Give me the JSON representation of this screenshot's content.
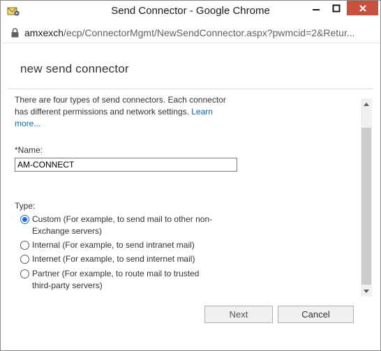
{
  "window": {
    "title": "Send Connector - Google Chrome",
    "close_color": "#c7503f"
  },
  "address": {
    "host": "amxexch",
    "path": "/ecp/ConnectorMgmt/NewSendConnector.aspx?pwmcid=2&Retur..."
  },
  "page": {
    "title": "new send connector",
    "intro_text": "There are four types of send connectors. Each connector has different permissions and network settings. ",
    "learn_more": "Learn more...",
    "name_label": "*Name:",
    "name_value": "AM-CONNECT",
    "type_label": "Type:",
    "types": [
      {
        "label": "Custom (For example, to send mail to other non-Exchange servers)",
        "checked": true
      },
      {
        "label": "Internal (For example, to send intranet mail)",
        "checked": false
      },
      {
        "label": "Internet (For example, to send internet mail)",
        "checked": false
      },
      {
        "label": "Partner (For example, to route mail to trusted third-party servers)",
        "checked": false
      }
    ]
  },
  "buttons": {
    "next": "Next",
    "cancel": "Cancel"
  },
  "accent_color": "#1f6fd0",
  "link_color": "#0b6aa8"
}
